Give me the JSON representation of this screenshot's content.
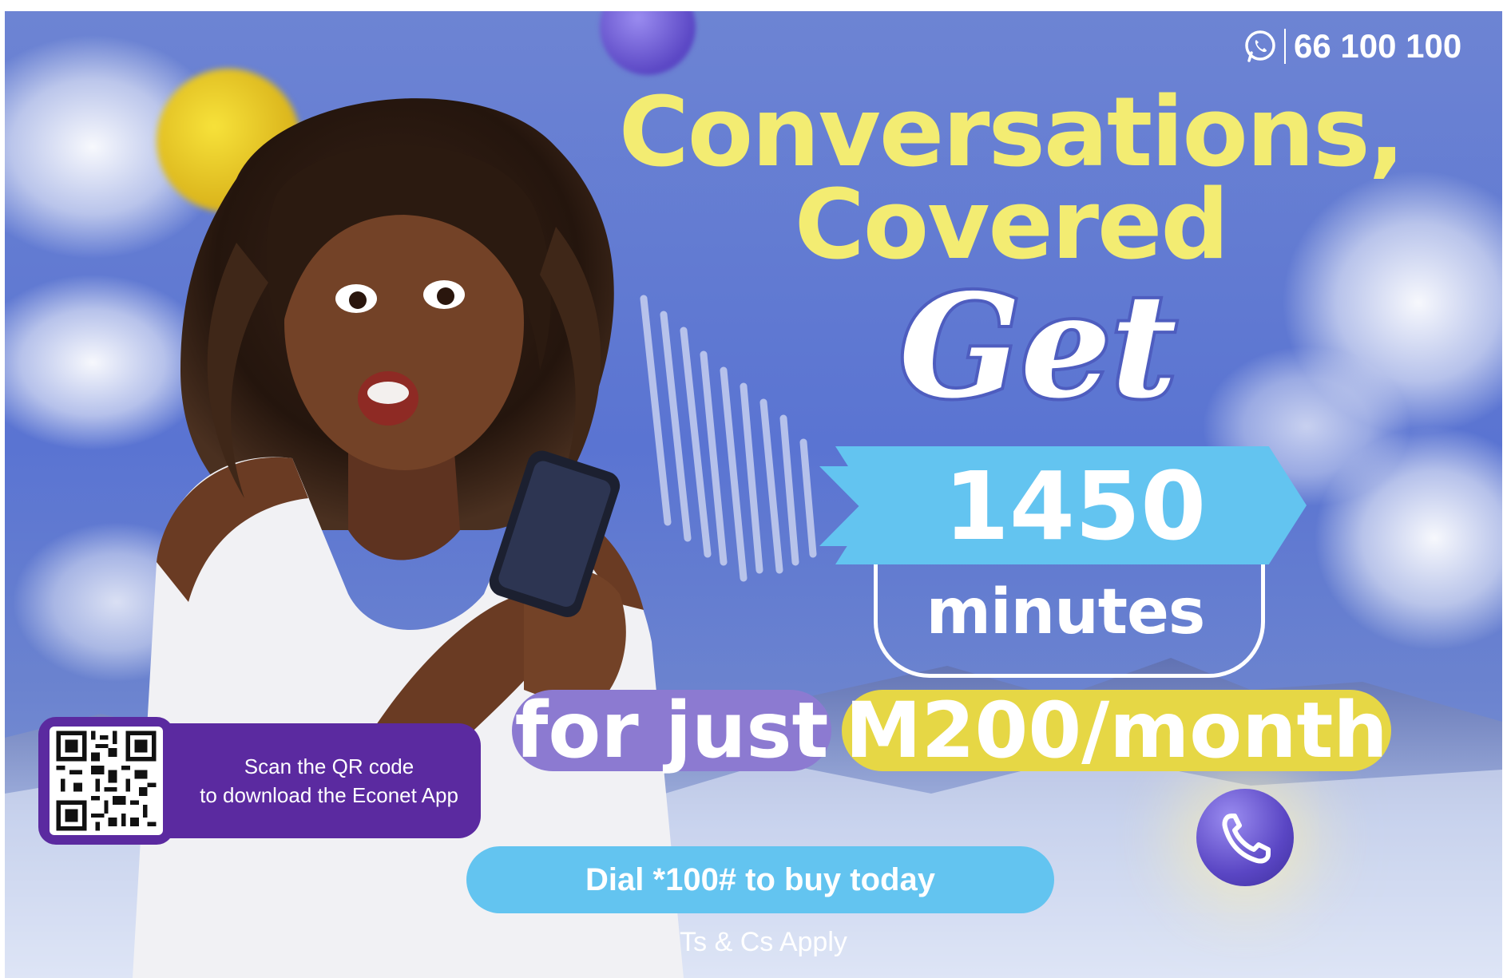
{
  "contact": {
    "whatsapp_icon": "whatsapp-icon",
    "number": "66 100 100"
  },
  "headline": {
    "line1": "Conversations,",
    "line2": "Covered"
  },
  "offer": {
    "get": "Get",
    "amount": "1450",
    "unit": "minutes",
    "for_just": "for just",
    "price": "M200/month"
  },
  "qr": {
    "line1": "Scan the QR code",
    "line2": "to download the Econet App"
  },
  "cta": {
    "dial": "Dial *100# to buy today"
  },
  "legal": "Ts & Cs Apply",
  "colors": {
    "background": "#5a74d2",
    "headline_yellow": "#f3ec72",
    "sky_blue": "#63c4f0",
    "lavender": "#8c7ad1",
    "price_yellow": "#e6d745",
    "qr_purple": "#5b2aa0"
  }
}
